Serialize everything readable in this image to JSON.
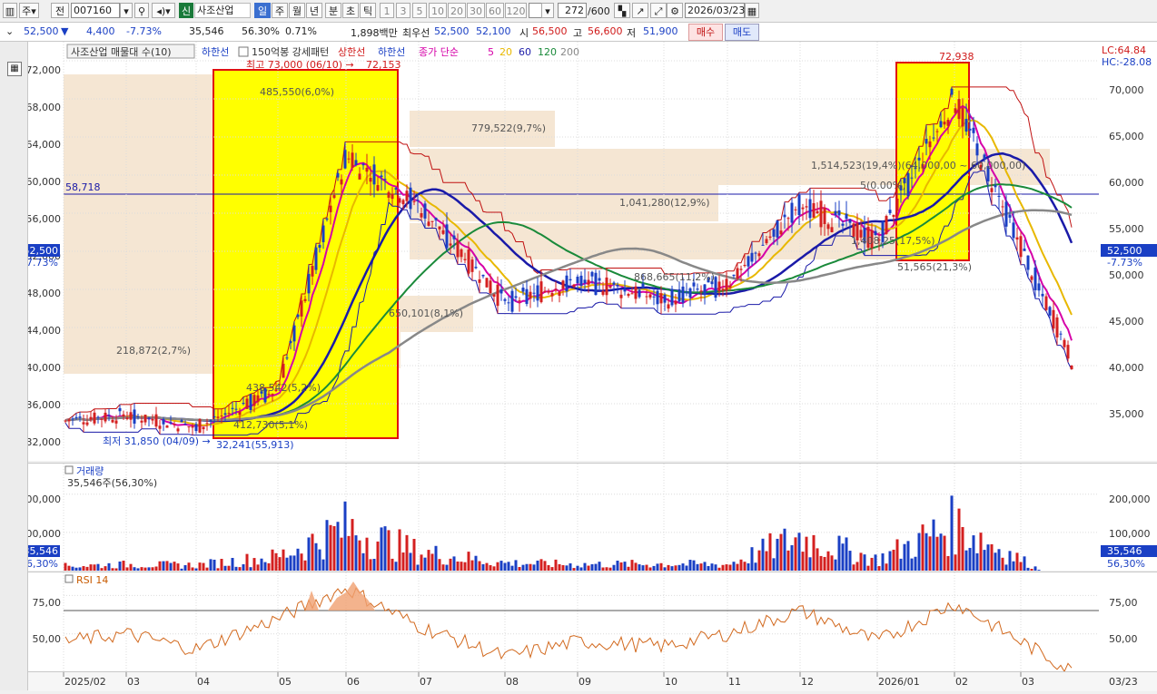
{
  "toolbar": {
    "btn_ju": "주",
    "btn_jeon": "전",
    "code": "007160",
    "shin_badge": "신",
    "stock_name": "사조산업",
    "periods": [
      "일",
      "주",
      "월",
      "년",
      "분",
      "초",
      "틱"
    ],
    "intervals": [
      "1",
      "3",
      "5",
      "10",
      "20",
      "30",
      "60",
      "120"
    ],
    "count": "272",
    "count_max": "/600",
    "date": "2026/03/23"
  },
  "info": {
    "price": "52,500",
    "change_arrow": "▼",
    "change": "4,400",
    "change_pct": "-7.73%",
    "volume": "35,546",
    "vol_ratio": "56.30%",
    "turnover": "0.71%",
    "amount": "1,898백만",
    "best_ask_label": "최우선",
    "best_ask": "52,500",
    "best_bid": "52,100",
    "open_label": "시",
    "open": "56,500",
    "high_label": "고",
    "high": "56,600",
    "low_label": "저",
    "low": "51,900",
    "buy_button": "매수",
    "sell_button": "매도"
  },
  "legend": {
    "title": "사조산업 매물대 수(10)",
    "lower_band": "하한선",
    "pattern": "150억봉 강세패턴",
    "upper_band": "상한선",
    "lower_band2": "하한선",
    "ma_label": "종가 단순",
    "ma_periods": [
      "5",
      "20",
      "60",
      "120",
      "200"
    ],
    "ma_colors": [
      "#d600a8",
      "#e8b800",
      "#1a1aa8",
      "#1a8a3a",
      "#888888"
    ]
  },
  "right_top": {
    "lc": "LC:64.84",
    "hc": "HC:-28.08"
  },
  "price_axis_left": [
    "72,000",
    "68,000",
    "64,000",
    "60,000",
    "56,000",
    "52,000",
    "48,000",
    "44,000",
    "40,000",
    "36,000",
    "32,000"
  ],
  "price_axis_right": [
    "70,000",
    "65,000",
    "60,000",
    "55,000",
    "50,000",
    "45,000",
    "40,000",
    "35,000"
  ],
  "current_tag": {
    "price": "52,500",
    "pct": "-7.73%"
  },
  "hline_label": "58,718",
  "annotations": {
    "high_mark": "최고 73,000 (06/10) →",
    "high_value": "72,153",
    "low_mark": "최저 31,850 (04/09) →",
    "low_value": "32,241(55,913)",
    "peak2": "72,938",
    "vp": [
      "485,550(6,0%)",
      "779,522(9,7%)",
      "1,041,280(12,9%)",
      "1,514,523(19,4%)(64,000,00 ~ 60,000,00)",
      "1,408,25(17,5%)",
      "650,101(8,1%)",
      "218,872(2,7%)",
      "438,542(5,2%)",
      "412,730(5,1%)",
      "868,665(11,2%)",
      "51,565(21,3%)",
      "5(0.00%)"
    ]
  },
  "volume_panel": {
    "title": "거래량",
    "subtitle": "35,546주(56,30%)",
    "axis": [
      "200,000",
      "100,000"
    ],
    "tag_value": "35,546",
    "tag_pct": "56,30%"
  },
  "rsi_panel": {
    "title": "RSI 14",
    "axis": [
      "75,00",
      "50,00"
    ]
  },
  "x_axis": [
    "2025/02",
    "03",
    "04",
    "05",
    "06",
    "07",
    "08",
    "09",
    "10",
    "11",
    "12",
    "2026/01",
    "02",
    "03"
  ],
  "x_axis_right": "03/23",
  "colors": {
    "up": "#d42020",
    "down": "#1a3fc4",
    "highlight": "#ffff00",
    "box_border": "#e01010",
    "vp_band": "#f5e6d3"
  },
  "chart_data": {
    "type": "candlestick",
    "title": "사조산업",
    "x": [
      "2025/02",
      "03",
      "04",
      "05",
      "06",
      "07",
      "08",
      "09",
      "10",
      "11",
      "12",
      "2026/01",
      "02",
      "03"
    ],
    "close_approx": [
      34200,
      34800,
      33500,
      37500,
      62000,
      57000,
      46500,
      49000,
      47000,
      48500,
      57000,
      53000,
      68000,
      52500
    ],
    "volume_approx": [
      15000,
      20000,
      18000,
      45000,
      140000,
      60000,
      25000,
      20000,
      22000,
      20000,
      110000,
      35000,
      150000,
      35546
    ],
    "rsi_approx": [
      45,
      50,
      40,
      60,
      80,
      55,
      35,
      45,
      42,
      50,
      65,
      45,
      70,
      45
    ],
    "ylim_left": [
      30000,
      74000
    ],
    "ylim_right": [
      30000,
      73000
    ],
    "volume_ylim": [
      0,
      280000
    ],
    "rsi_ylim": [
      25,
      90
    ]
  }
}
